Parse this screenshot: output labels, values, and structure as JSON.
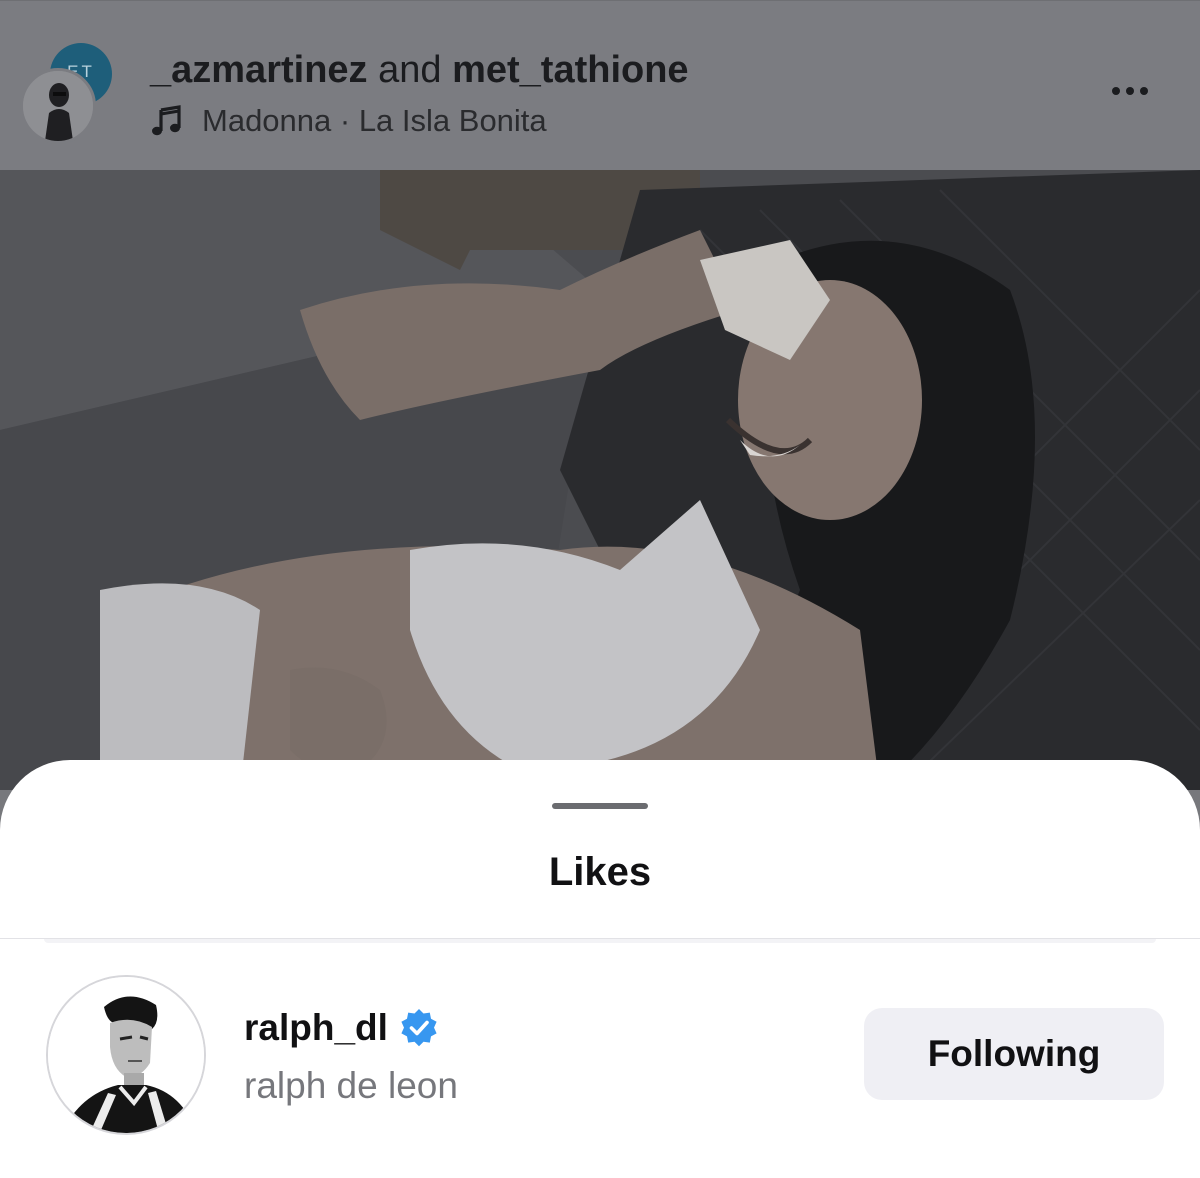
{
  "post": {
    "user_primary": "_azmartinez",
    "joiner": " and ",
    "user_secondary": "met_tathione",
    "audio": "Madonna · La Isla Bonita",
    "collab_avatar_text": "ET"
  },
  "icons": {
    "music": "music-note-icon",
    "more": "more-horizontal-icon",
    "verified": "verified-badge-icon"
  },
  "likes_sheet": {
    "title": "Likes",
    "users": [
      {
        "username": "ralph_dl",
        "full_name": "ralph de leon",
        "verified": true,
        "button_label": "Following"
      }
    ]
  },
  "colors": {
    "verified": "#3797f0",
    "button_bg": "#efeff4",
    "secondary_text": "#76777c"
  }
}
